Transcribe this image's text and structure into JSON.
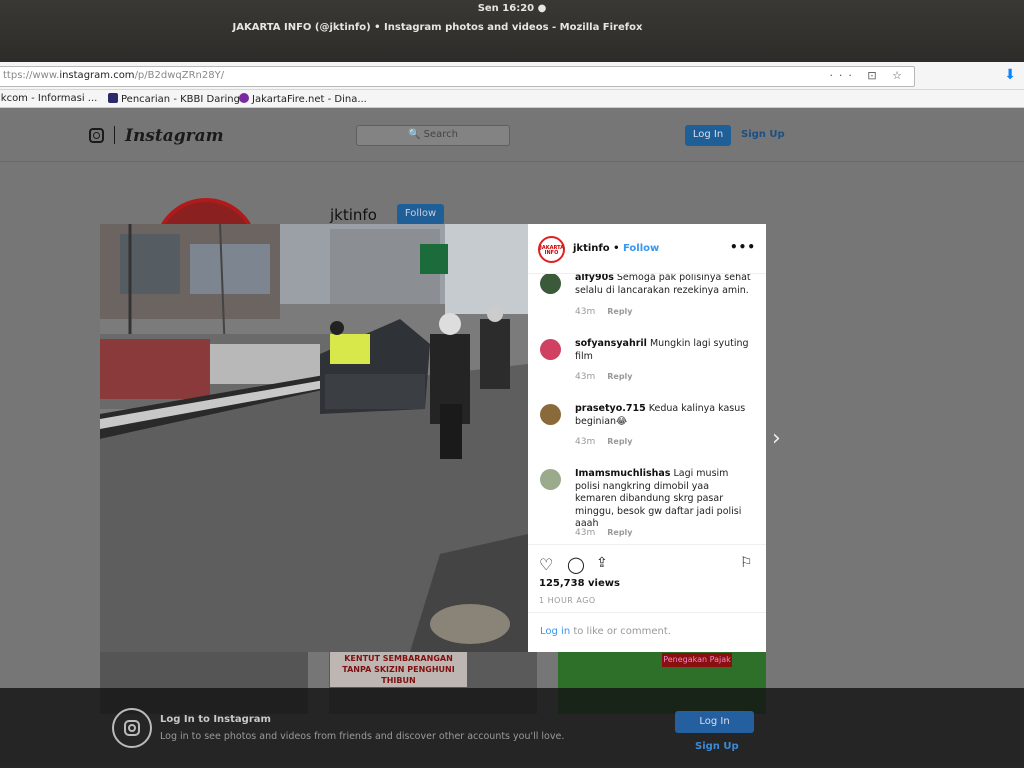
{
  "os": {
    "clock": "Sen 16:20 ●"
  },
  "window": {
    "title": "JAKARTA INFO (@jktinfo) • Instagram photos and videos - Mozilla Firefox"
  },
  "urlbar": {
    "prefix": "ttps://www.",
    "domain": "instagram.com",
    "path": "/p/B2dwqZRn28Y/",
    "icons": "··· ⊡ ☆"
  },
  "bookmarks": [
    {
      "label": "ikcom - Informasi ...",
      "color": "#ffffff"
    },
    {
      "label": "Pencarian - KBBI Daring",
      "color": "#2a2a6a"
    },
    {
      "label": "JakartaFire.net - Dina...",
      "color": "#7a2aa0"
    }
  ],
  "instagram": {
    "logo": "Instagram",
    "search_placeholder": "Search",
    "login": "Log In",
    "signup": "Sign Up",
    "profile_name": "jktinfo",
    "follow": "Follow"
  },
  "grid": {
    "banner_text": "KENTUT SEMBARANGAN TANPA SKIZIN PENGHUNI THIBUN",
    "pill_text": "Penegakan Pajak"
  },
  "post": {
    "avatar_text": "JAKARTA INFO",
    "username": "jktinfo",
    "follow": "Follow",
    "more": "•••",
    "comments": [
      {
        "user": "alfy90s",
        "text": "Semoga pak polisinya sehat selalu di lancarakan rezekinya amin.",
        "time": "43m",
        "reply": "Reply",
        "avatar_color": "#3a5a3a"
      },
      {
        "user": "sofyansyahril",
        "text": "Mungkin lagi syuting film",
        "time": "43m",
        "reply": "Reply",
        "avatar_color": "#d04060"
      },
      {
        "user": "prasetyo.715",
        "text": "Kedua kalinya kasus beginian😂",
        "time": "43m",
        "reply": "Reply",
        "avatar_color": "#8a6a3a"
      },
      {
        "user": "Imamsmuchlishas",
        "text": "Lagi musim polisi nangkring dimobil yaa kemaren dibandung skrg pasar minggu, besok gw daftar jadi polisi aaah",
        "time": "43m",
        "reply": "Reply",
        "avatar_color": "#9aaa8a"
      }
    ],
    "views": "125,738 views",
    "time_ago": "1 HOUR AGO",
    "login_link": "Log in",
    "login_rest": " to like or comment."
  },
  "login_banner": {
    "title": "Log In to Instagram",
    "subtitle": "Log in to see photos and videos from friends and discover other accounts you'll love.",
    "login": "Log In",
    "signup": "Sign Up"
  },
  "colors": {
    "accent": "#3897f0",
    "ig_button": "#2460a0"
  }
}
